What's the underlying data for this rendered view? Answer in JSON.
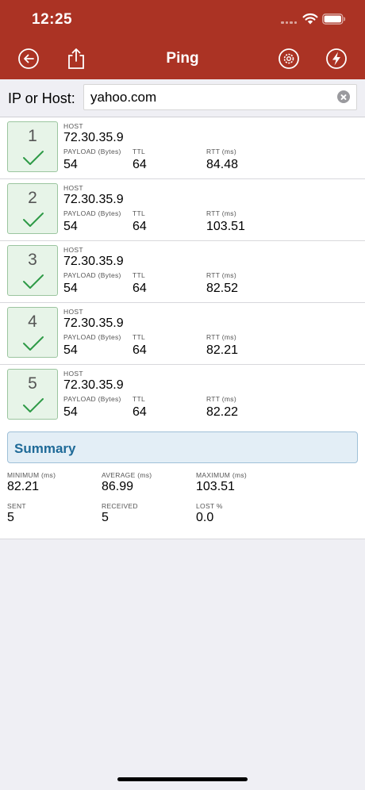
{
  "status_bar": {
    "time": "12:25"
  },
  "nav": {
    "title": "Ping",
    "icons": [
      "back-arrow-icon",
      "share-icon",
      "gear-icon",
      "lightning-icon"
    ]
  },
  "host_input": {
    "label": "IP or Host:",
    "value": "yahoo.com"
  },
  "result_labels": {
    "host": "HOST",
    "payload": "PAYLOAD (Bytes)",
    "ttl": "TTL",
    "rtt": "RTT (ms)"
  },
  "results": [
    {
      "seq": "1",
      "host": "72.30.35.9",
      "payload": "54",
      "ttl": "64",
      "rtt": "84.48"
    },
    {
      "seq": "2",
      "host": "72.30.35.9",
      "payload": "54",
      "ttl": "64",
      "rtt": "103.51"
    },
    {
      "seq": "3",
      "host": "72.30.35.9",
      "payload": "54",
      "ttl": "64",
      "rtt": "82.52"
    },
    {
      "seq": "4",
      "host": "72.30.35.9",
      "payload": "54",
      "ttl": "64",
      "rtt": "82.21"
    },
    {
      "seq": "5",
      "host": "72.30.35.9",
      "payload": "54",
      "ttl": "64",
      "rtt": "82.22"
    }
  ],
  "summary": {
    "title": "Summary",
    "minimum_label": "MINIMUM (ms)",
    "minimum": "82.21",
    "average_label": "AVERAGE (ms)",
    "average": "86.99",
    "maximum_label": "MAXIMUM (ms)",
    "maximum": "103.51",
    "sent_label": "SENT",
    "sent": "5",
    "received_label": "RECEIVED",
    "received": "5",
    "lost_label": "LOST %",
    "lost": "0.0"
  },
  "colors": {
    "nav_background": "#ab3324",
    "success_green": "#2e9a47",
    "summary_blue": "#1f6a98"
  }
}
